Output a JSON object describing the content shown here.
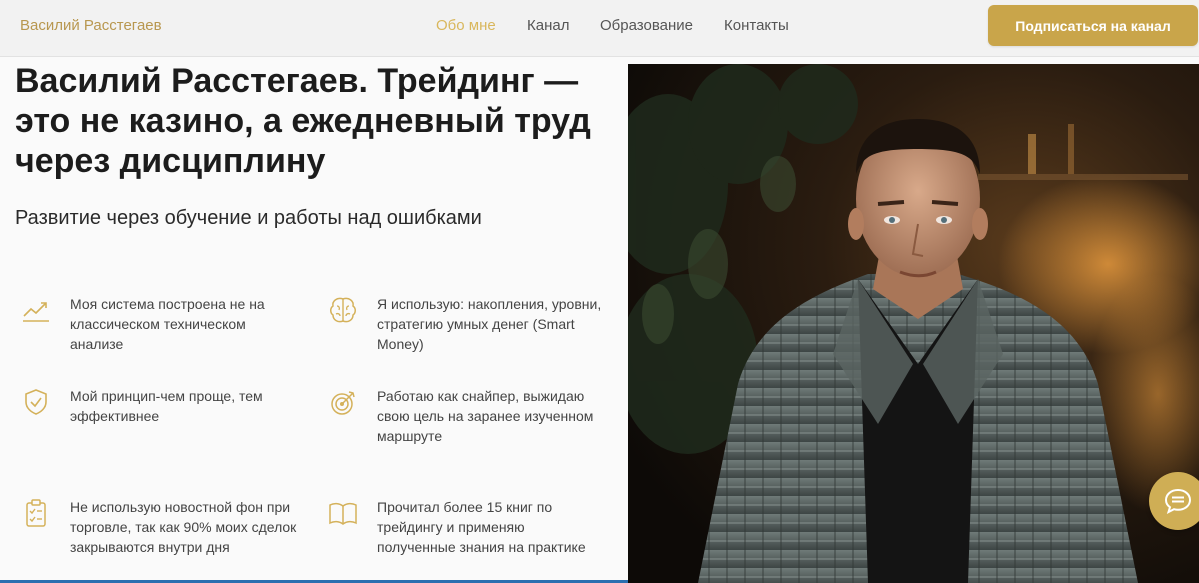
{
  "header": {
    "logo": "Василий Расстегаев",
    "nav": [
      {
        "label": "Обо мне",
        "active": true
      },
      {
        "label": "Канал",
        "active": false
      },
      {
        "label": "Образование",
        "active": false
      },
      {
        "label": "Контакты",
        "active": false
      }
    ],
    "cta_label": "Подписаться на канал"
  },
  "hero": {
    "title": "Василий Расстегаев. Трейдинг — это не казино, а ежедневный труд через дисциплину",
    "subtitle": "Развитие через обучение и работы над ошибками"
  },
  "features": [
    {
      "icon": "chart-trend-icon",
      "text": "Моя система построена не на классическом техническом анализе"
    },
    {
      "icon": "brain-icon",
      "text": "Я использую: накопления, уровни, стратегию умных денег (Smart Money)"
    },
    {
      "icon": "shield-check-icon",
      "text": "Мой принцип-чем проще, тем эффективнее"
    },
    {
      "icon": "target-icon",
      "text": "Работаю как снайпер, выжидаю свою цель на заранее изученном маршруте"
    },
    {
      "icon": "clipboard-icon",
      "text": "Не использую новостной фон при торговле, так как 90% моих сделок закрываются внутри дня"
    },
    {
      "icon": "book-icon",
      "text": "Прочитал более 15 книг по трейдингу и применяю полученные знания на практике"
    }
  ],
  "colors": {
    "accent": "#c9a54a",
    "nav_active": "#d9b75c",
    "logo": "#b8974f"
  }
}
